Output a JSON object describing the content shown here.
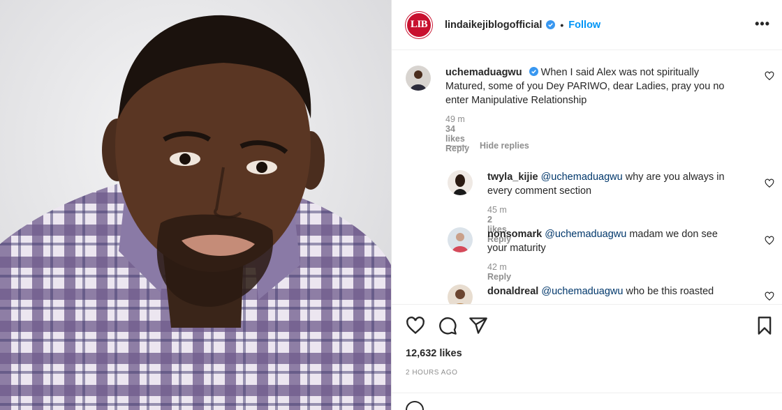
{
  "post": {
    "photo_alt": "photo-of-man-in-plaid-shirt",
    "likes": "12,632 likes",
    "time_ago": "2 HOURS AGO"
  },
  "header": {
    "logo_text": "LIB",
    "username": "lindaikejiblogofficial",
    "separator": "•",
    "follow_label": "Follow",
    "more_label": "•••"
  },
  "comments": [
    {
      "username": "uchemaduagwu",
      "text": "When I said Alex was not spiritually Matured, some of you Dey PARIWO, dear Ladies, pray you no enter Manipulative Relationship",
      "time": "49 m",
      "likes": "34 likes",
      "reply_label": "Reply"
    }
  ],
  "hide_replies_label": "Hide replies",
  "replies": [
    {
      "username": "twyla_kijie",
      "mention": "@uchemaduagwu",
      "text": "why are you always in every comment section",
      "time": "45 m",
      "likes": "2 likes",
      "reply_label": "Reply"
    },
    {
      "username": "nonsomark",
      "mention": "@uchemaduagwu",
      "text": "madam we don see your maturity",
      "time": "42 m",
      "likes": "",
      "reply_label": "Reply"
    },
    {
      "username": "donaldreal",
      "mention": "@uchemaduagwu",
      "text": "who be this roasted",
      "time": "",
      "likes": "",
      "reply_label": ""
    }
  ],
  "colors": {
    "accent": "#0095f6",
    "verified": "#3897f0",
    "logo_red": "#c8102e",
    "mention": "#00376b",
    "muted": "#8e8e8e"
  },
  "icons": [
    "heart-icon",
    "comment-icon",
    "share-icon",
    "bookmark-icon",
    "verified-badge-icon",
    "more-options-icon"
  ]
}
